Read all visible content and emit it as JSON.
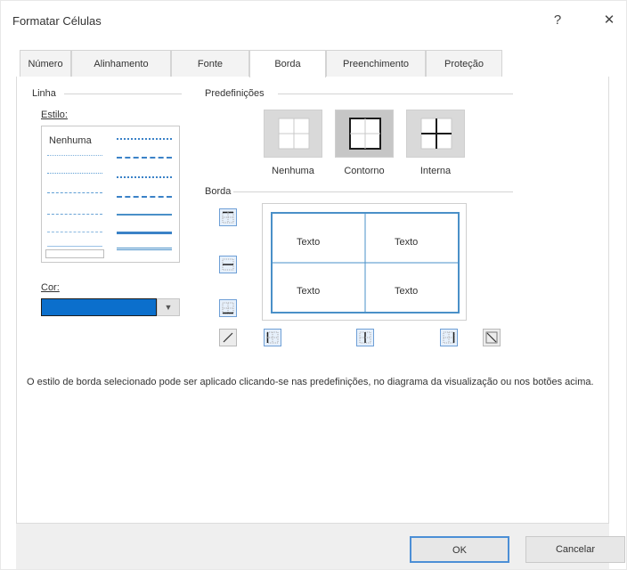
{
  "window": {
    "title": "Formatar Células",
    "help_label": "?",
    "close_label": "✕"
  },
  "tabs": [
    {
      "label": "Número"
    },
    {
      "label": "Alinhamento"
    },
    {
      "label": "Fonte"
    },
    {
      "label": "Borda",
      "active": true
    },
    {
      "label": "Preenchimento"
    },
    {
      "label": "Proteção"
    }
  ],
  "line_group": {
    "title": "Linha",
    "style_label": "Estilo:",
    "none_style": "Nenhuma",
    "color_label": "Cor:",
    "selected_color": "#0b6fcc"
  },
  "presets": {
    "title": "Predefinições",
    "items": [
      {
        "label": "Nenhuma",
        "icon": "preset-none-icon"
      },
      {
        "label": "Contorno",
        "icon": "preset-outline-icon"
      },
      {
        "label": "Interna",
        "icon": "preset-inside-icon"
      }
    ]
  },
  "border": {
    "title": "Borda",
    "cells": [
      "Texto",
      "Texto",
      "Texto",
      "Texto"
    ],
    "accent": "#4a90c8"
  },
  "description": "O estilo de borda selecionado pode ser aplicado clicando-se nas predefinições, no diagrama da visualização ou nos botões acima.",
  "buttons": {
    "ok": "OK",
    "cancel": "Cancelar"
  }
}
